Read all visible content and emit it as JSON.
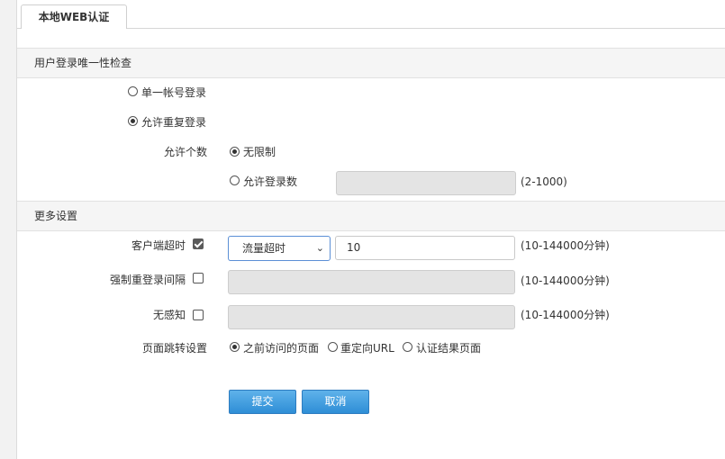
{
  "tab": {
    "label": "本地WEB认证"
  },
  "unique_login": {
    "header": "用户登录唯一性检查",
    "options": [
      {
        "label": "单一帐号登录",
        "selected": false
      },
      {
        "label": "允许重复登录",
        "selected": true
      }
    ],
    "count_label": "允许个数",
    "count_options": [
      {
        "label": "无限制",
        "selected": true
      },
      {
        "label": "允许登录数",
        "selected": false
      }
    ],
    "count_value": "",
    "count_range": "(2-1000)"
  },
  "more": {
    "header": "更多设置",
    "client_timeout": {
      "label": "客户端超时",
      "checked": true,
      "mode_selected": "流量超时",
      "value": "10",
      "range": "(10-144000分钟)"
    },
    "forced_relogin": {
      "label": "强制重登录间隔",
      "checked": false,
      "value": "",
      "range": "(10-144000分钟)"
    },
    "seamless": {
      "label": "无感知",
      "checked": false,
      "value": "",
      "range": "(10-144000分钟)"
    },
    "redirect": {
      "label": "页面跳转设置",
      "options": [
        {
          "label": "之前访问的页面",
          "selected": true
        },
        {
          "label": "重定向URL",
          "selected": false
        },
        {
          "label": "认证结果页面",
          "selected": false
        }
      ]
    }
  },
  "buttons": {
    "submit": "提交",
    "cancel": "取消"
  }
}
